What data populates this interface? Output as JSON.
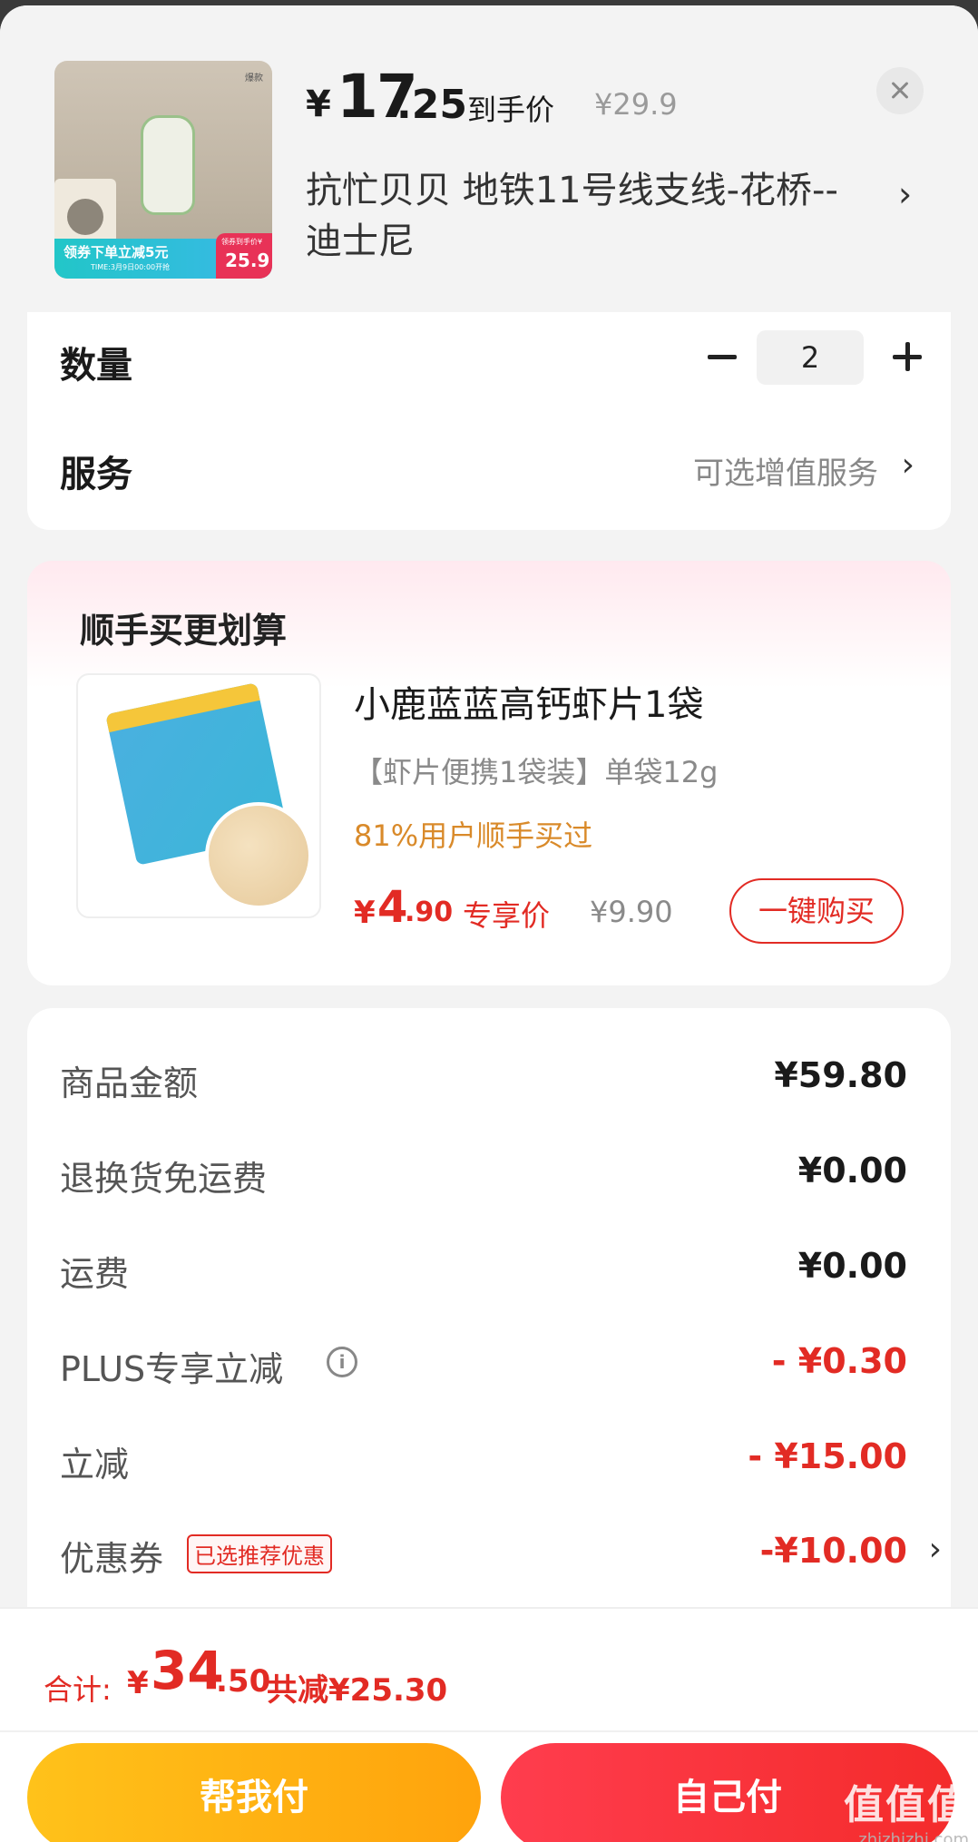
{
  "product": {
    "thumb": {
      "tag": "爆款",
      "banner_text": "领券下单立减5元",
      "banner_sub": "TIME:3月9日00:00开抢",
      "badge_label": "领券到手价¥",
      "badge_value": "25.9"
    },
    "price": {
      "currency": "¥",
      "integer": "17",
      "decimal": ".25",
      "label": "到手价",
      "original": "¥29.9"
    },
    "spec": "抗忙贝贝  地铁11号线支线-花桥--迪士尼",
    "spec_arrow": "›"
  },
  "quantity": {
    "label": "数量",
    "value": "2"
  },
  "service": {
    "label": "服务",
    "value": "可选增值服务",
    "arrow": "›"
  },
  "addon": {
    "title": "顺手买更划算",
    "name": "小鹿蓝蓝高钙虾片1袋",
    "desc": "【虾片便携1袋装】单袋12g",
    "social": "81%用户顺手买过",
    "price": {
      "currency": "¥",
      "integer": "4",
      "decimal": ".90",
      "label": "专享价"
    },
    "original": "¥9.90",
    "buy_label": "一键购买"
  },
  "summary": {
    "rows": [
      {
        "label": "商品金额",
        "value": "¥59.80"
      },
      {
        "label": "退换货免运费",
        "value": "¥0.00"
      },
      {
        "label": "运费",
        "value": "¥0.00"
      },
      {
        "label": "PLUS专享立减",
        "value": "- ¥0.30"
      },
      {
        "label": "立减",
        "value": "- ¥15.00"
      },
      {
        "label": "优惠券",
        "value": "-¥10.00",
        "tag": "已选推荐优惠"
      }
    ]
  },
  "footer": {
    "total_label": "合计:",
    "currency": "¥",
    "integer": "34",
    "decimal": ".50",
    "saved": "共减¥25.30",
    "help_pay": "帮我付",
    "self_pay": "自己付",
    "watermark": "值值值",
    "watermark_url": "zhizhizhi.com"
  },
  "colors": {
    "accent_red": "#e22b24",
    "orange": "#d98a2a",
    "help_button": "#ffb515",
    "pay_button": "#f4333c"
  }
}
